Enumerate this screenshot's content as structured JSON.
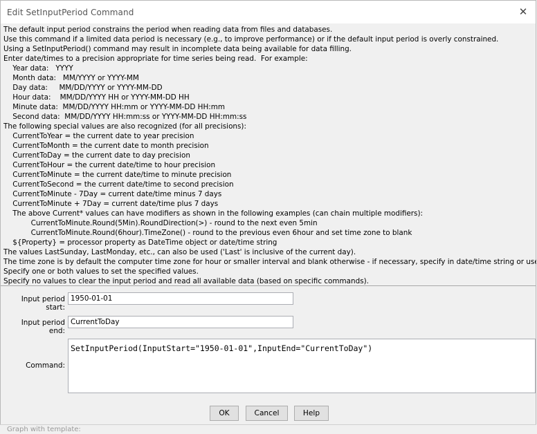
{
  "window": {
    "title": "Edit SetInputPeriod Command",
    "close_glyph": "✕"
  },
  "description_lines": [
    "The default input period constrains the period when reading data from files and databases.",
    "Use this command if a limited data period is necessary (e.g., to improve performance) or if the default input period is overly constrained.",
    "Using a SetInputPeriod() command may result in incomplete data being available for data filling.",
    "Enter date/times to a precision appropriate for time series being read.  For example:",
    "    Year data:   YYYY",
    "    Month data:   MM/YYYY or YYYY-MM",
    "    Day data:     MM/DD/YYYY or YYYY-MM-DD",
    "    Hour data:    MM/DD/YYYY HH or YYYY-MM-DD HH",
    "    Minute data:  MM/DD/YYYY HH:mm or YYYY-MM-DD HH:mm",
    "    Second data:  MM/DD/YYYY HH:mm:ss or YYYY-MM-DD HH:mm:ss",
    "The following special values are also recognized (for all precisions):",
    "    CurrentToYear = the current date to year precision",
    "    CurrentToMonth = the current date to month precision",
    "    CurrentToDay = the current date to day precision",
    "    CurrentToHour = the current date/time to hour precision",
    "    CurrentToMinute = the current date/time to minute precision",
    "    CurrentToSecond = the current date/time to second precision",
    "    CurrentToMinute - 7Day = current date/time minus 7 days",
    "    CurrentToMinute + 7Day = current date/time plus 7 days",
    "    The above Current* values can have modifiers as shown in the following examples (can chain multiple modifiers):",
    "            CurrentToMinute.Round(5Min).RoundDirection(>) - round to the next even 5min",
    "            CurrentToMinute.Round(6hour).TimeZone() - round to the previous even 6hour and set time zone to blank",
    "    ${Property} = processor property as DateTime object or date/time string",
    "The values LastSunday, LastMonday, etc., can also be used ('Last' is inclusive of the current day).",
    "The time zone is by default the computer time zone for hour or smaller interval and blank otherwise - if necessary, specify in date/time string or use .Timezone().",
    "Specify one or both values to set the specified values.",
    "Specify no values to clear the input period and read all available data (based on specific commands)."
  ],
  "form": {
    "start_label": "Input period start:",
    "start_value": "1950-01-01",
    "end_label": "Input period end:",
    "end_value": "CurrentToDay",
    "command_label": "Command:",
    "command_value": "SetInputPeriod(InputStart=\"1950-01-01\",InputEnd=\"CurrentToDay\")"
  },
  "buttons": {
    "ok": "OK",
    "cancel": "Cancel",
    "help": "Help"
  },
  "background_text": "Graph with template:"
}
